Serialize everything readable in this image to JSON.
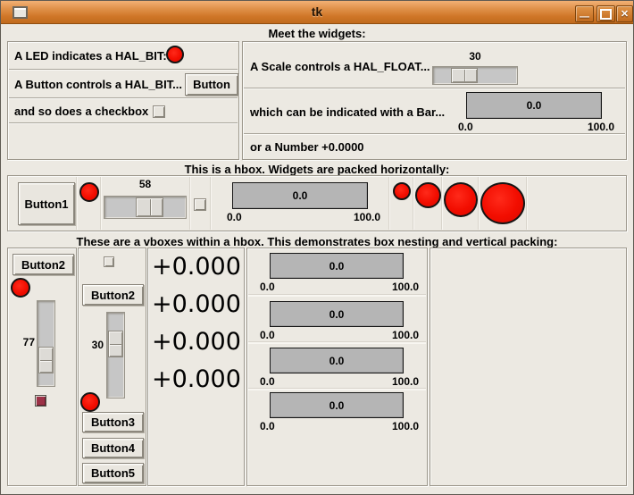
{
  "window": {
    "title": "tk",
    "minimize_glyph": "—",
    "close_glyph": "✕"
  },
  "colors": {
    "led_red": "#f20d00",
    "titlebar_orange": "#d67c2a",
    "checkbox_checked": "#9c3147",
    "background": "#ece9e2",
    "bar_fill": "#b5b5b5"
  },
  "meet": {
    "header": "Meet the widgets:",
    "left": {
      "led_label": "A LED indicates a HAL_BIT:",
      "button_row_label": "A Button controls a HAL_BIT...",
      "button_text": "Button",
      "checkbox_label": "and so does a checkbox"
    },
    "right": {
      "scale_label": "A Scale controls a HAL_FLOAT...",
      "scale_value": "30",
      "bar_label": "which can be indicated with a Bar...",
      "bar_value": "0.0",
      "bar_min": "0.0",
      "bar_max": "100.0",
      "number_label": "or a Number +0.0000"
    }
  },
  "hbox": {
    "header": "This is a hbox. Widgets are packed horizontally:",
    "button1": "Button1",
    "scale_value": "58",
    "bar": {
      "value": "0.0",
      "min": "0.0",
      "max": "100.0"
    }
  },
  "vbox": {
    "header": "These are a vboxes within a hbox. This demonstrates box nesting and vertical packing:",
    "col1": {
      "button": "Button2",
      "scale_value": "77"
    },
    "col2": {
      "button_top": "Button2",
      "scale_value": "30",
      "button3": "Button3",
      "button4": "Button4",
      "button5": "Button5"
    },
    "numbers": [
      "+0.000",
      "+0.000",
      "+0.000",
      "+0.000"
    ],
    "bars": [
      {
        "value": "0.0",
        "min": "0.0",
        "max": "100.0"
      },
      {
        "value": "0.0",
        "min": "0.0",
        "max": "100.0"
      },
      {
        "value": "0.0",
        "min": "0.0",
        "max": "100.0"
      },
      {
        "value": "0.0",
        "min": "0.0",
        "max": "100.0"
      }
    ]
  }
}
